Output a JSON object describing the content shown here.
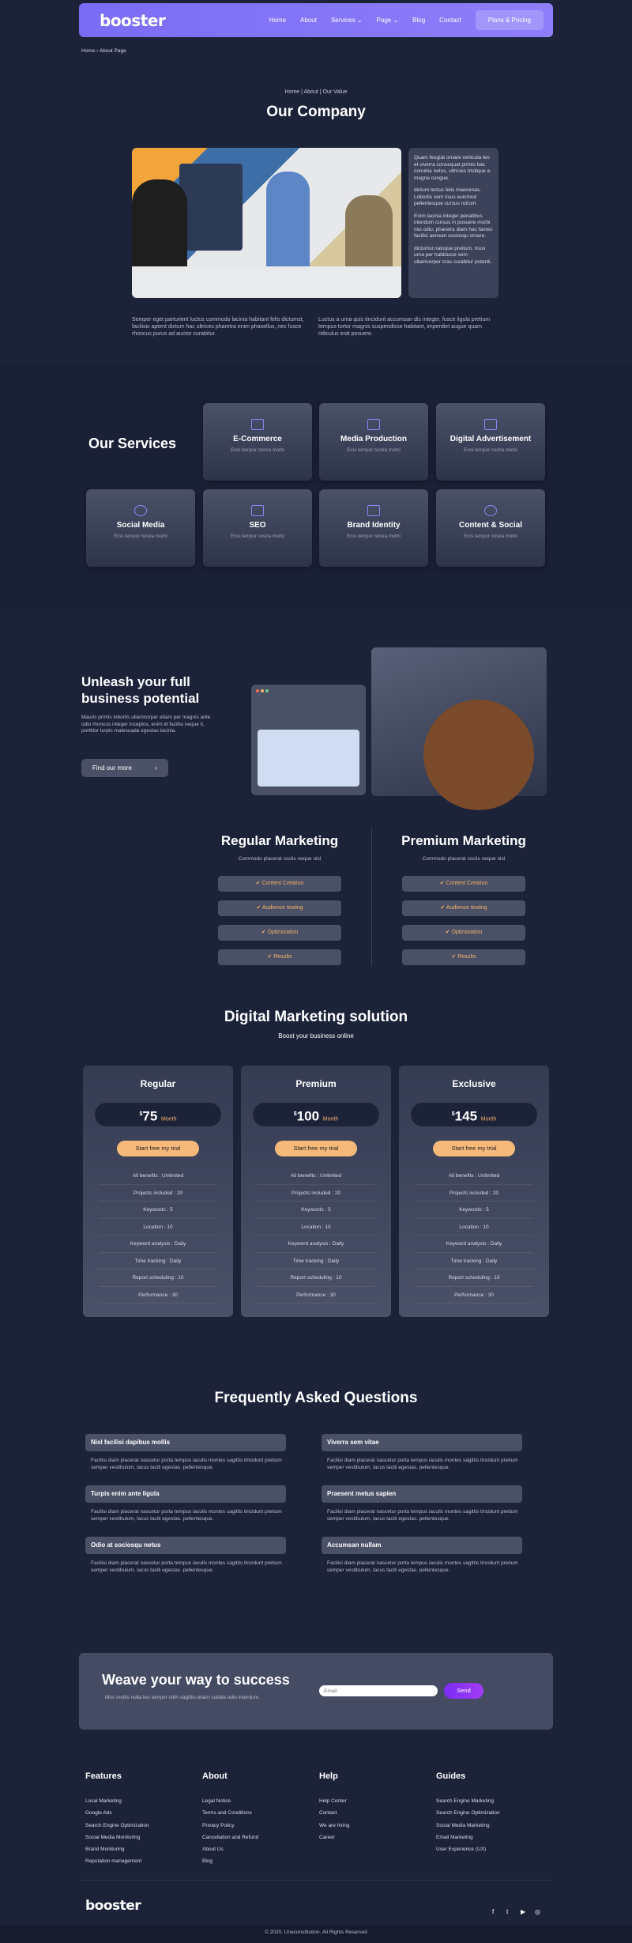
{
  "nav": {
    "logo": "booster",
    "links": [
      "Home",
      "About",
      "Services ⌄",
      "Page ⌄",
      "Blog",
      "Contact"
    ],
    "cta": "Plans & Pricing"
  },
  "breadcrumb": "Home › About Page",
  "hero": {
    "crumbs": "Home  |  About  |  Our Value",
    "title": "Our Company",
    "side": [
      "Quam feugiat ornare vehicula leo et viverra consequat primis hac conubia netus, ultricies tristique a magna congue.",
      "dictum lectus felis maecenas. Lobortis sem risus euismod pellentesque cursus rutrum.",
      "Enim lacinia integer penatibus interdum cursus in posuere morbi nisi odio, pharetra diam hac fames facilisi aenean sociosqu ornare.",
      "dictumst natoque pretium, risus urna per habitasse sem ullamcorper cras curabitur potenti."
    ],
    "left_text": "Semper eget parturient luctus commodo lacinia habitant felis dictumst, facilisis aptent dictum hac ultrices pharetra enim phasellus, nec fusce rhoncus purus ad auctor curabitur.",
    "right_text": "Luctus a urna quis tincidunt accumsan dis integer, fusce ligula pretium tempus tortor magnis suspendisse habitant, imperdiet augue quam ridiculus erat posuere."
  },
  "services": {
    "title": "Our Services",
    "items": [
      {
        "t": "E-Commerce",
        "s": "Eros tempor nostra morbi"
      },
      {
        "t": "Media Production",
        "s": "Eros tempor nostra morbi"
      },
      {
        "t": "Digital Advertisement",
        "s": "Eros tempor nostra morbi"
      },
      {
        "t": "Social Media",
        "s": "Eros tempor nostra morbi"
      },
      {
        "t": "SEO",
        "s": "Eros tempor nostra morbi"
      },
      {
        "t": "Brand Identity",
        "s": "Eros tempor nostra morbi"
      },
      {
        "t": "Content & Social",
        "s": "Eros tempor nostra morbi"
      }
    ]
  },
  "unleash": {
    "title": "Unleash your full business potential",
    "text": "Mauris primis lobortis ullamcorper etiam per magnis ante odio rhoncus integer inceptos, enim id facilisi neque it, porttitor turpis malesuada egestas lacinia.",
    "btn": "Find our more"
  },
  "marketing": {
    "left": {
      "title": "Regular Marketing",
      "sub": "Commodo placerat sociis neque nisl"
    },
    "right": {
      "title": "Premium Marketing",
      "sub": "Commodo placerat sociis neque nisl"
    },
    "items": [
      "✔  Content Creation",
      "✔  Audience testing",
      "✔  Optimization",
      "✔  Results"
    ]
  },
  "pricing": {
    "title": "Digital Marketing solution",
    "sub": "Boost your business online",
    "plans": [
      {
        "name": "Regular",
        "price": "75"
      },
      {
        "name": "Premium",
        "price": "100"
      },
      {
        "name": "Exclusive",
        "price": "145"
      }
    ],
    "currency": "$",
    "per": "Month",
    "cta": "Start free my trial",
    "features": [
      "All benefits : Unlimited",
      "Projects included : 20",
      "Keywords : 5",
      "Location : 10",
      "Keyword analysis : Daily",
      "Time tracking : Daily",
      "Report scheduling : 10",
      "Performance : 30"
    ]
  },
  "faq": {
    "title": "Frequently Asked Questions",
    "answer": "Facilisi diam placerat nascetur porta tempus iaculis montes sagittis tincidunt pretium semper vestibulum, lacus taciti egestas. pellentesque.",
    "q": [
      "Nisl facilisi dapibus mollis",
      "Turpis enim ante ligula",
      "Odio at sociosqu netus",
      "Viverra sem vitae",
      "Praesent metus sapien",
      "Accumsan nullam"
    ]
  },
  "newsletter": {
    "title": "Weave your way to success",
    "text": "Mos mollis nulla leo tempor nibh sagittis etiam cubilia odio interdum.",
    "placeholder": "Email",
    "btn": "Send"
  },
  "footer": {
    "cols": [
      {
        "h": "Features",
        "items": [
          "Local Marketing",
          "Google Ads",
          "Search Engine Optimization",
          "Social Media Monitoring",
          "Brand Monitoring",
          "Reputation management"
        ]
      },
      {
        "h": "About",
        "items": [
          "Legal Notice",
          "Terms and Conditions",
          "Privacy Policy",
          "Cancellation and Refund",
          "About Us",
          "Blog"
        ]
      },
      {
        "h": "Help",
        "items": [
          "Help Center",
          "Contact",
          "We are hiring",
          "Career"
        ]
      },
      {
        "h": "Guides",
        "items": [
          "Search Engine Marketing",
          "Search Engine Optimization",
          "Social Media Marketing",
          "Email Marketing",
          "User Experience (UX)"
        ]
      }
    ],
    "logo": "booster",
    "copyright": "© 2020, Uneconstitution. All Rights Reserved"
  },
  "colors": {
    "bg": "#1c2238",
    "accent": "#7b6cf6",
    "orange": "#f6b97a"
  }
}
